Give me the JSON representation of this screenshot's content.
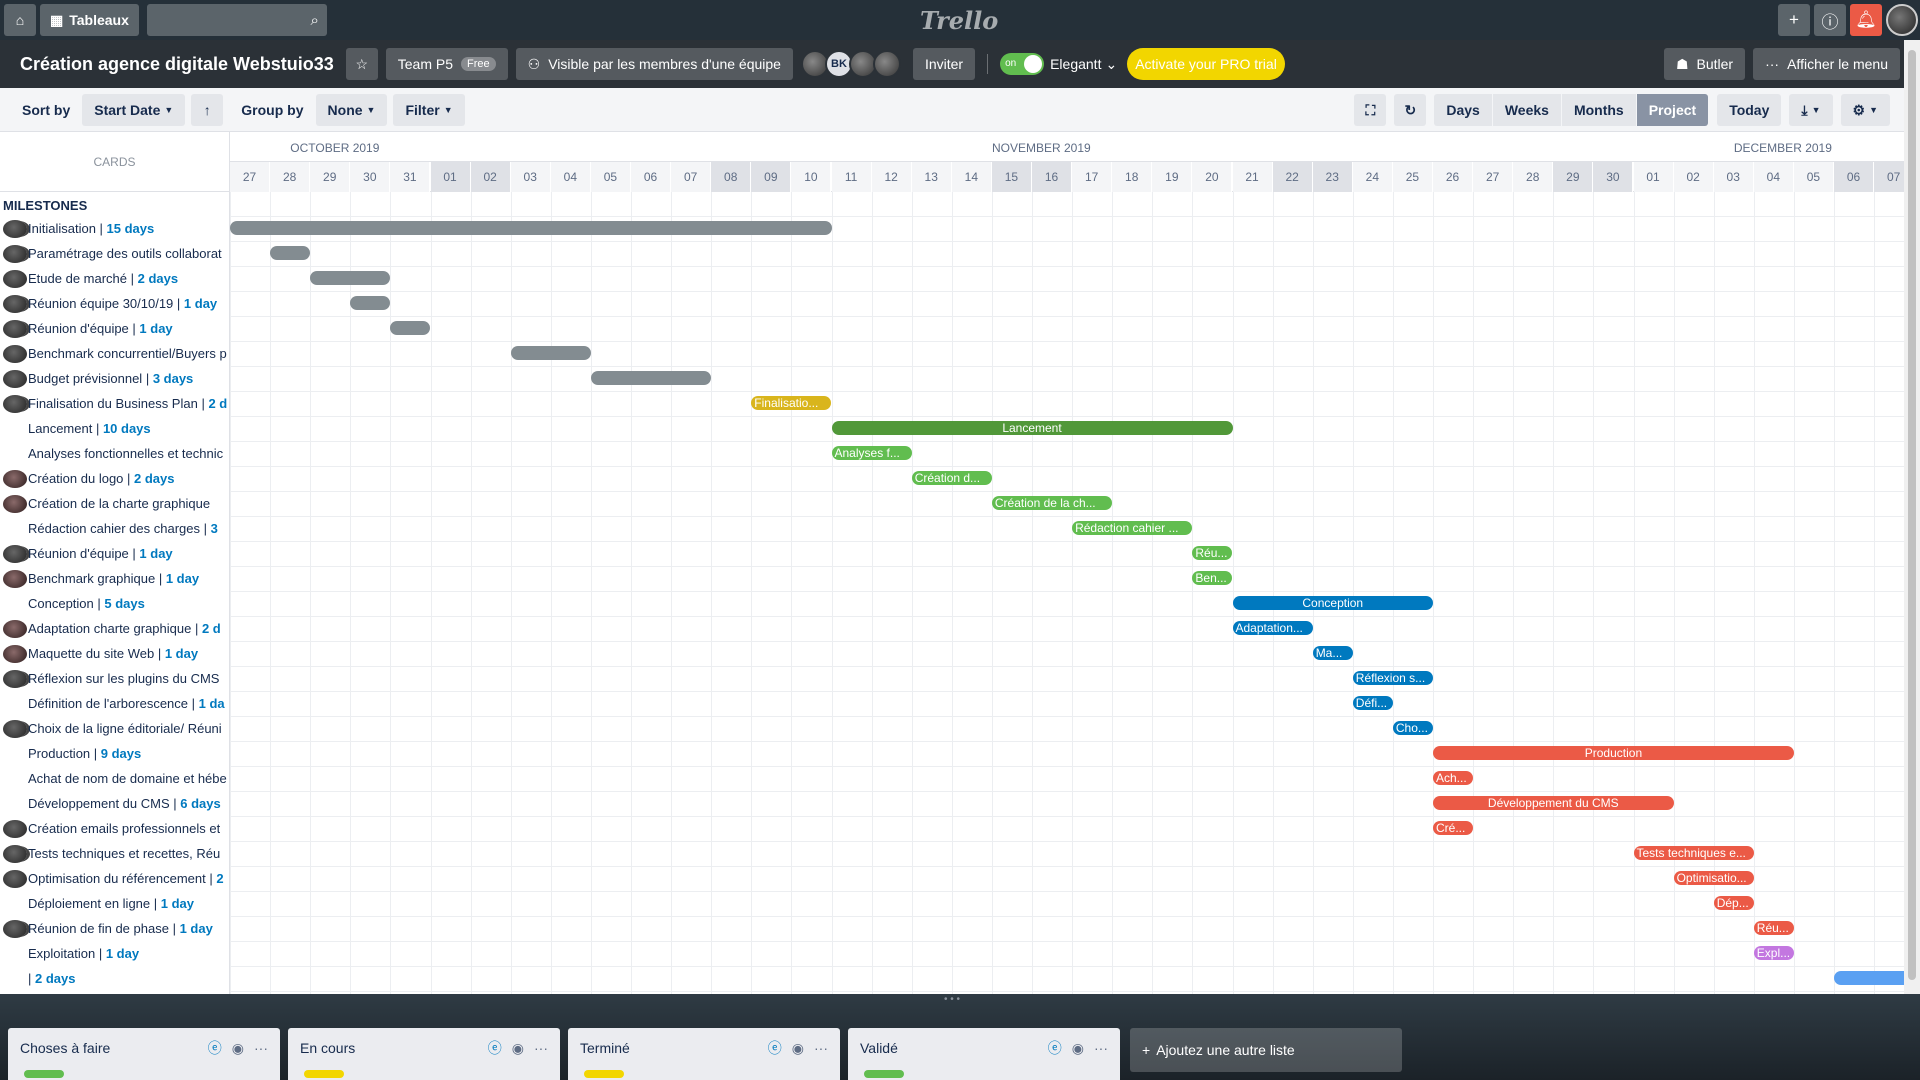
{
  "topbar": {
    "boards_label": "Tableaux",
    "logo_text": "Trello"
  },
  "header": {
    "title": "Création agence digitale Webstuio33",
    "team": "Team P5",
    "team_badge": "Free",
    "visibility": "Visible par les membres d'une équipe",
    "avatar_initials": "BK",
    "invite": "Inviter",
    "toggle_state": "on",
    "toggle_label": "Elegantt",
    "pro_trial": "Activate your PRO trial",
    "butler": "Butler",
    "show_menu": "Afficher le menu"
  },
  "toolbar": {
    "sort_by": "Sort by",
    "sort_value": "Start Date",
    "group_by": "Group by",
    "group_value": "None",
    "filter": "Filter",
    "views": [
      "Days",
      "Weeks",
      "Months",
      "Project",
      "Today"
    ],
    "active_view": "Project"
  },
  "gantt": {
    "cards_header": "CARDS",
    "milestones_label": "MILESTONES",
    "months": [
      {
        "label": "OCTOBER 2019",
        "start_index": 0,
        "span": 5
      },
      {
        "label": "NOVEMBER 2019",
        "start_index": 5,
        "span": 30
      },
      {
        "label": "DECEMBER 2019",
        "start_index": 35,
        "span": 7
      }
    ],
    "days": [
      "27",
      "28",
      "29",
      "30",
      "31",
      "01",
      "02",
      "03",
      "04",
      "05",
      "06",
      "07",
      "08",
      "09",
      "10",
      "11",
      "12",
      "13",
      "14",
      "15",
      "16",
      "17",
      "18",
      "19",
      "20",
      "21",
      "22",
      "23",
      "24",
      "25",
      "26",
      "27",
      "28",
      "29",
      "30",
      "01",
      "02",
      "03",
      "04",
      "05",
      "06",
      "07"
    ],
    "weekend_indices": [
      5,
      6,
      12,
      13,
      19,
      20,
      26,
      27,
      33,
      34,
      40,
      41
    ],
    "rows": [
      {
        "name": "Initialisation",
        "dur": "15 days",
        "icon": "double",
        "bar": {
          "start": 0,
          "len": 15,
          "color": "#838c91",
          "label": ""
        }
      },
      {
        "name": "Paramétrage des outils collaborat",
        "dur": "",
        "icon": "double",
        "bar": {
          "start": 1,
          "len": 1,
          "color": "#838c91",
          "label": ""
        }
      },
      {
        "name": "Etude de marché",
        "dur": "2 days",
        "icon": "single",
        "bar": {
          "start": 2,
          "len": 2,
          "color": "#838c91",
          "label": ""
        }
      },
      {
        "name": "Réunion équipe 30/10/19",
        "dur": "1 day",
        "icon": "double",
        "bar": {
          "start": 3,
          "len": 1,
          "color": "#838c91",
          "label": ""
        }
      },
      {
        "name": "Réunion d'équipe",
        "dur": "1 day",
        "icon": "double",
        "bar": {
          "start": 4,
          "len": 1,
          "color": "#838c91",
          "label": ""
        }
      },
      {
        "name": "Benchmark concurrentiel/Buyers p",
        "dur": "",
        "icon": "single",
        "bar": {
          "start": 7,
          "len": 2,
          "color": "#838c91",
          "label": ""
        }
      },
      {
        "name": "Budget prévisionnel",
        "dur": "3 days",
        "icon": "single",
        "bar": {
          "start": 9,
          "len": 3,
          "color": "#838c91",
          "label": ""
        }
      },
      {
        "name": "Finalisation du Business Plan",
        "dur": "2 d",
        "icon": "double",
        "bar": {
          "start": 13,
          "len": 2,
          "color": "#d9b51c",
          "label": "Finalisatio..."
        }
      },
      {
        "name": "Lancement",
        "dur": "10 days",
        "icon": "none",
        "bar": {
          "start": 15,
          "len": 10,
          "color": "#519839",
          "label": "Lancement",
          "parent": true
        }
      },
      {
        "name": "Analyses fonctionnelles et technic",
        "dur": "",
        "icon": "none",
        "bar": {
          "start": 15,
          "len": 2,
          "color": "#61bd4f",
          "label": "Analyses f..."
        }
      },
      {
        "name": "Création du logo",
        "dur": "2 days",
        "icon": "dark",
        "bar": {
          "start": 17,
          "len": 2,
          "color": "#61bd4f",
          "label": "Création d..."
        }
      },
      {
        "name": "Création de la charte graphique",
        "dur": "",
        "icon": "dark",
        "bar": {
          "start": 19,
          "len": 3,
          "color": "#61bd4f",
          "label": "Création de la ch..."
        }
      },
      {
        "name": "Rédaction cahier des charges",
        "dur": "3",
        "icon": "none",
        "bar": {
          "start": 21,
          "len": 3,
          "color": "#61bd4f",
          "label": "Rédaction cahier ..."
        }
      },
      {
        "name": "Réunion d'équipe",
        "dur": "1 day",
        "icon": "double",
        "bar": {
          "start": 24,
          "len": 1,
          "color": "#61bd4f",
          "label": "Réu..."
        }
      },
      {
        "name": "Benchmark graphique",
        "dur": "1 day",
        "icon": "dark",
        "bar": {
          "start": 24,
          "len": 1,
          "color": "#61bd4f",
          "label": "Ben..."
        }
      },
      {
        "name": "Conception",
        "dur": "5 days",
        "icon": "none",
        "bar": {
          "start": 25,
          "len": 5,
          "color": "#0079bf",
          "label": "Conception",
          "parent": true
        }
      },
      {
        "name": "Adaptation charte graphique",
        "dur": "2 d",
        "icon": "dark",
        "bar": {
          "start": 25,
          "len": 2,
          "color": "#0079bf",
          "label": "Adaptation..."
        }
      },
      {
        "name": "Maquette du site Web",
        "dur": "1 day",
        "icon": "dark",
        "bar": {
          "start": 27,
          "len": 1,
          "color": "#0079bf",
          "label": "Ma..."
        }
      },
      {
        "name": "Réflexion sur les plugins du CMS",
        "dur": "",
        "icon": "double",
        "bar": {
          "start": 28,
          "len": 2,
          "color": "#0079bf",
          "label": "Réflexion s..."
        }
      },
      {
        "name": "Définition de l'arborescence",
        "dur": "1 da",
        "icon": "none",
        "bar": {
          "start": 28,
          "len": 1,
          "color": "#0079bf",
          "label": "Défi..."
        }
      },
      {
        "name": "Choix de la ligne éditoriale/ Réuni",
        "dur": "",
        "icon": "double",
        "bar": {
          "start": 29,
          "len": 1,
          "color": "#0079bf",
          "label": "Cho..."
        }
      },
      {
        "name": "Production",
        "dur": "9 days",
        "icon": "none",
        "bar": {
          "start": 30,
          "len": 9,
          "color": "#eb5a46",
          "label": "Production",
          "parent": true
        }
      },
      {
        "name": "Achat de nom de domaine et hébe",
        "dur": "",
        "icon": "none",
        "bar": {
          "start": 30,
          "len": 1,
          "color": "#eb5a46",
          "label": "Ach..."
        }
      },
      {
        "name": "Développement du CMS",
        "dur": "6 days",
        "icon": "none",
        "bar": {
          "start": 30,
          "len": 6,
          "color": "#eb5a46",
          "label": "Développement du CMS",
          "parent": true
        }
      },
      {
        "name": "Création emails professionnels et",
        "dur": "",
        "icon": "single",
        "bar": {
          "start": 30,
          "len": 1,
          "color": "#eb5a46",
          "label": "Cré..."
        }
      },
      {
        "name": "Tests techniques et recettes, Réu",
        "dur": "",
        "icon": "double",
        "bar": {
          "start": 35,
          "len": 3,
          "color": "#eb5a46",
          "label": "Tests techniques e..."
        }
      },
      {
        "name": "Optimisation du référencement",
        "dur": "2",
        "icon": "single",
        "bar": {
          "start": 36,
          "len": 2,
          "color": "#eb5a46",
          "label": "Optimisatio..."
        }
      },
      {
        "name": "Déploiement en ligne",
        "dur": "1 day",
        "icon": "none",
        "bar": {
          "start": 37,
          "len": 1,
          "color": "#eb5a46",
          "label": "Dép..."
        }
      },
      {
        "name": "Réunion de fin de phase",
        "dur": "1 day",
        "icon": "double",
        "bar": {
          "start": 38,
          "len": 1,
          "color": "#eb5a46",
          "label": "Réu..."
        }
      },
      {
        "name": "Exploitation",
        "dur": "1 day",
        "icon": "none",
        "bar": {
          "start": 38,
          "len": 1,
          "color": "#c377e0",
          "label": "Expl..."
        }
      },
      {
        "name": "",
        "dur": "2 days",
        "icon": "none",
        "bar": {
          "start": 40,
          "len": 2,
          "color": "#5aa0f2",
          "label": ""
        }
      }
    ]
  },
  "lists": [
    {
      "name": "Choses à faire",
      "label_color": "#61bd4f"
    },
    {
      "name": "En cours",
      "label_color": "#f2d600"
    },
    {
      "name": "Terminé",
      "label_color": "#f2d600"
    },
    {
      "name": "Validé",
      "label_color": "#61bd4f"
    }
  ],
  "add_list": "Ajoutez une autre liste"
}
